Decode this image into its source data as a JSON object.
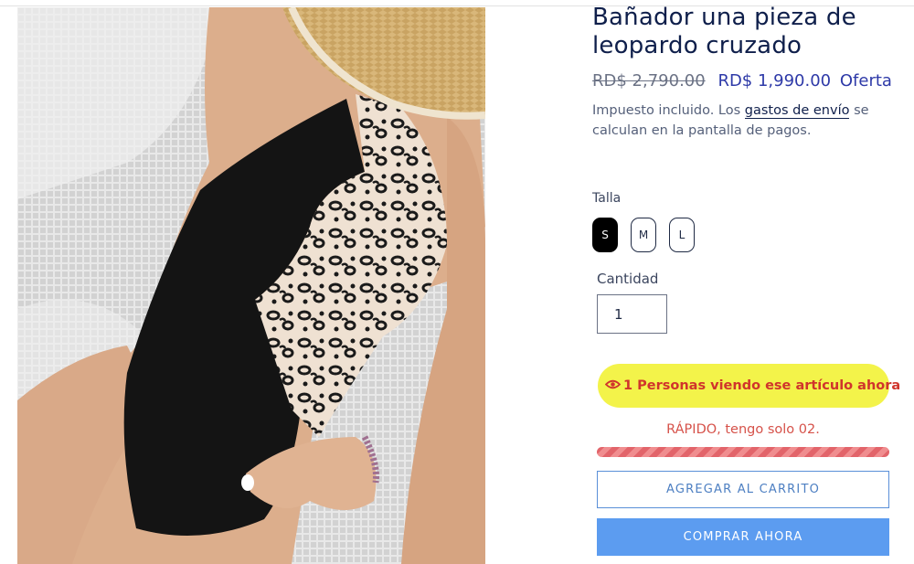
{
  "product": {
    "title": "Bañador una pieza de leopardo cruzado",
    "price_old": "RD$ 2,790.00",
    "price_new": "RD$ 1,990.00",
    "price_badge": "Oferta",
    "tax_text_before": "Impuesto incluido. Los ",
    "tax_link": "gastos de envío",
    "tax_text_after": " se calculan en la pantalla de pagos."
  },
  "size": {
    "label": "Talla",
    "options": [
      "S",
      "M",
      "L"
    ],
    "selected": "S"
  },
  "quantity": {
    "label": "Cantidad",
    "value": "1"
  },
  "urgency": {
    "viewers_text": "1 Personas viendo ese artículo ahora",
    "stock_text": "RÁPIDO, tengo solo 02."
  },
  "actions": {
    "add_to_cart": "AGREGAR AL CARRITO",
    "buy_now": "COMPRAR AHORA"
  },
  "colors": {
    "title": "#0f1f4b",
    "price": "#2e3aa8",
    "viewers_bg": "#f3f34a",
    "viewers_text": "#d0342c",
    "stock_text": "#d6524a",
    "buy_now_bg": "#5c9cf0"
  },
  "icons": {
    "viewers": "eye-icon"
  }
}
